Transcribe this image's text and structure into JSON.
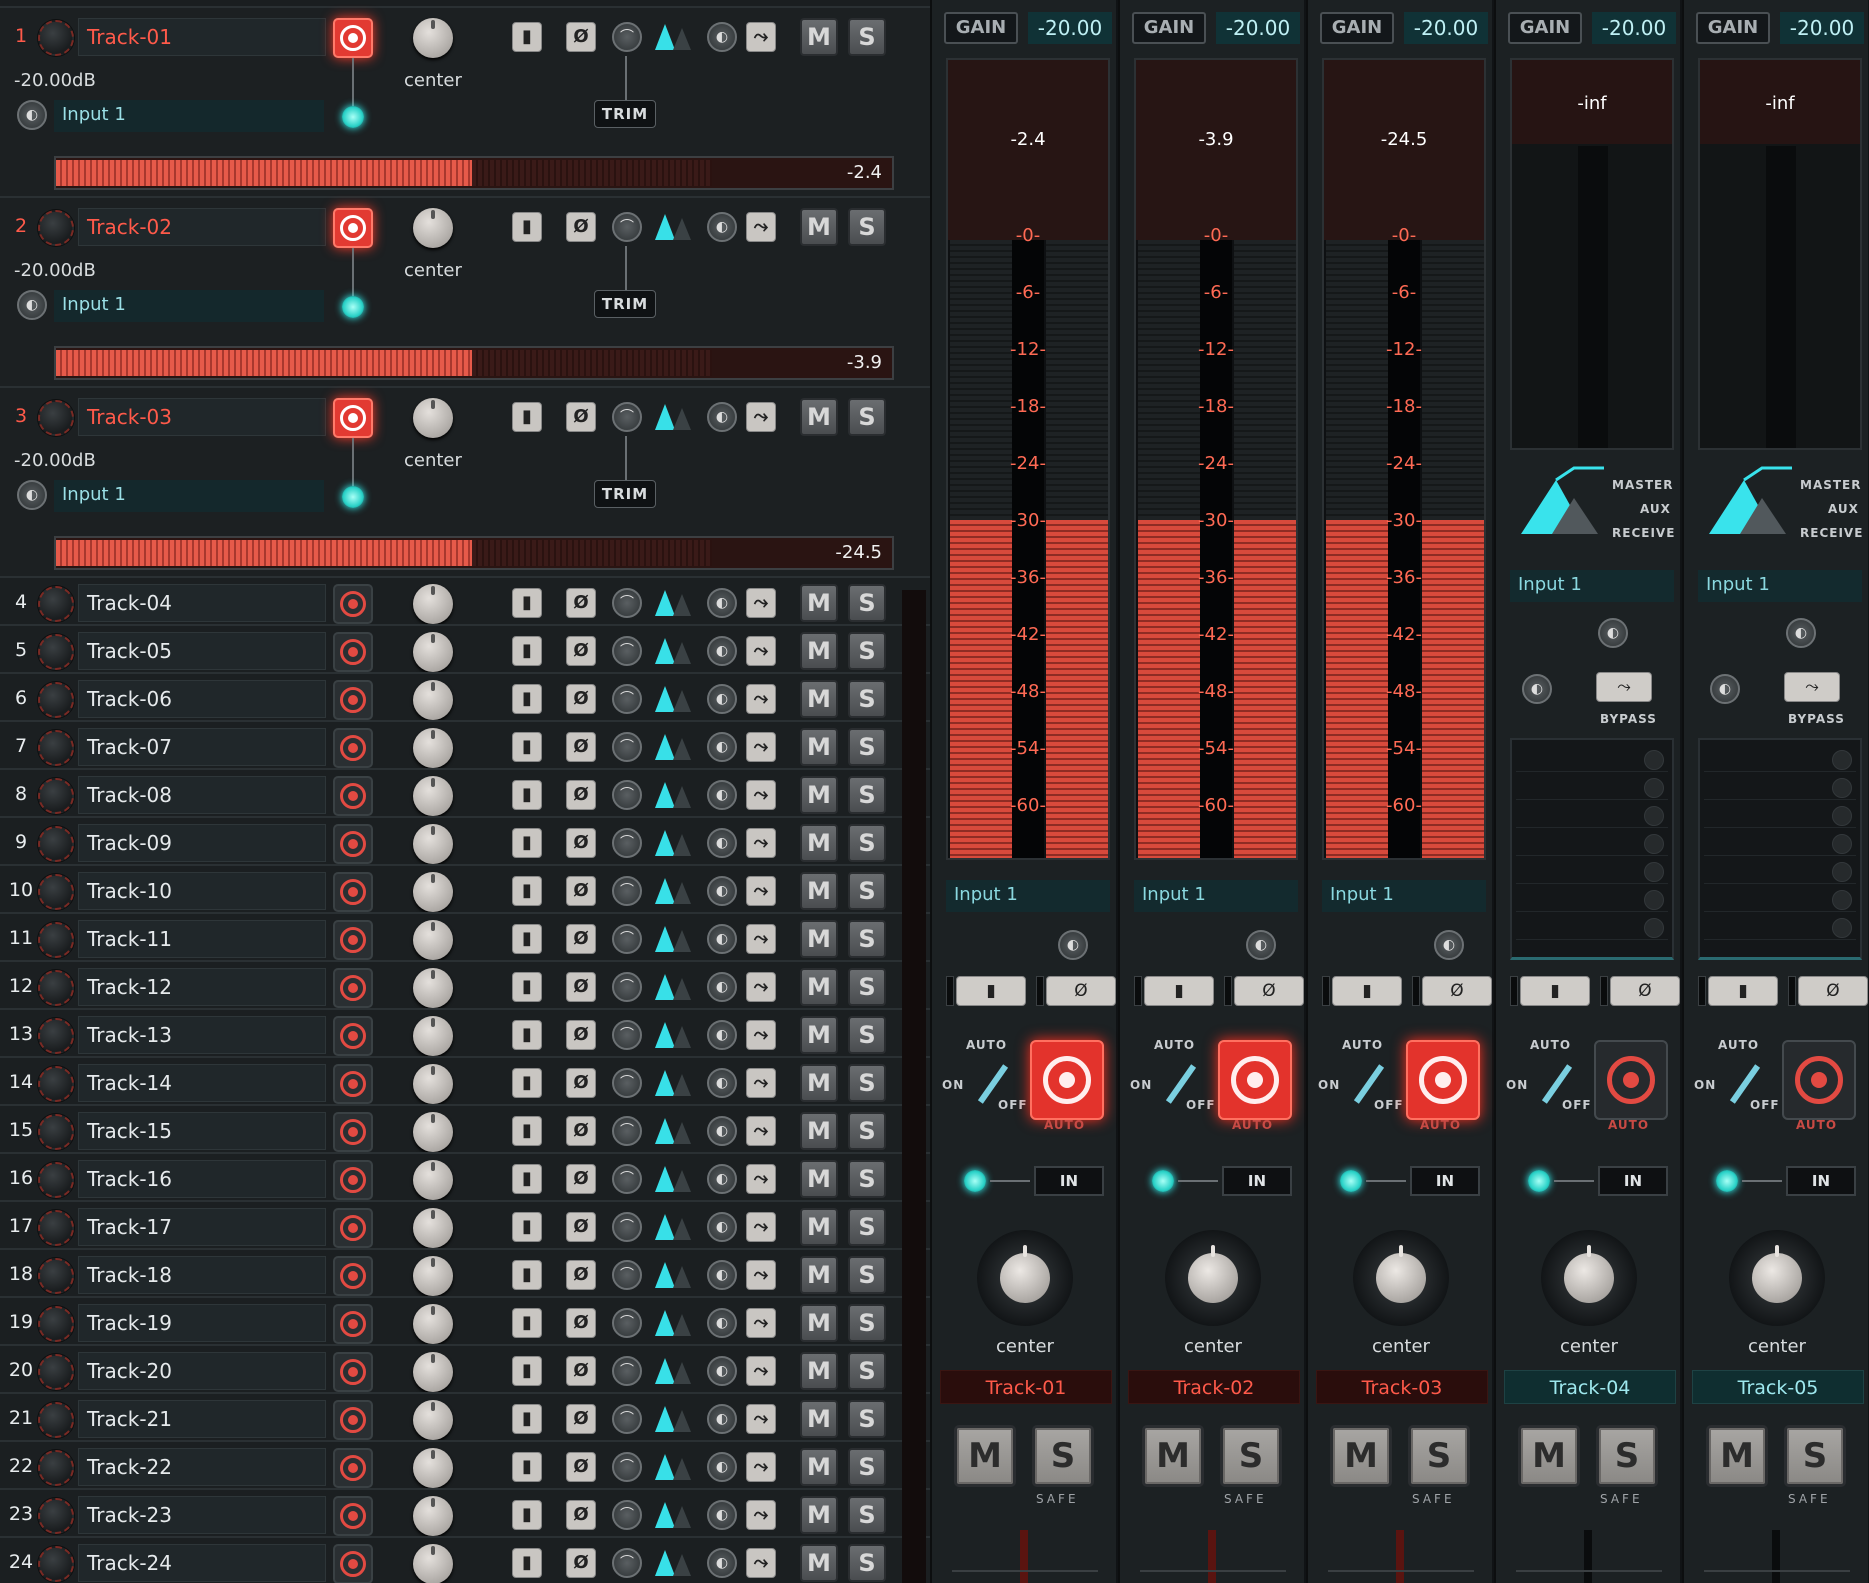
{
  "tracks": [
    {
      "num": "1",
      "name": "Track-01",
      "armed": true,
      "expanded": true,
      "gain": "-20.00dB",
      "input": "Input 1",
      "pan": "center",
      "trim": "TRIM",
      "level": "-2.4"
    },
    {
      "num": "2",
      "name": "Track-02",
      "armed": true,
      "expanded": true,
      "gain": "-20.00dB",
      "input": "Input 1",
      "pan": "center",
      "trim": "TRIM",
      "level": "-3.9"
    },
    {
      "num": "3",
      "name": "Track-03",
      "armed": true,
      "expanded": true,
      "gain": "-20.00dB",
      "input": "Input 1",
      "pan": "center",
      "trim": "TRIM",
      "level": "-24.5"
    },
    {
      "num": "4",
      "name": "Track-04"
    },
    {
      "num": "5",
      "name": "Track-05"
    },
    {
      "num": "6",
      "name": "Track-06"
    },
    {
      "num": "7",
      "name": "Track-07"
    },
    {
      "num": "8",
      "name": "Track-08"
    },
    {
      "num": "9",
      "name": "Track-09"
    },
    {
      "num": "10",
      "name": "Track-10"
    },
    {
      "num": "11",
      "name": "Track-11"
    },
    {
      "num": "12",
      "name": "Track-12"
    },
    {
      "num": "13",
      "name": "Track-13"
    },
    {
      "num": "14",
      "name": "Track-14"
    },
    {
      "num": "15",
      "name": "Track-15"
    },
    {
      "num": "16",
      "name": "Track-16"
    },
    {
      "num": "17",
      "name": "Track-17"
    },
    {
      "num": "18",
      "name": "Track-18"
    },
    {
      "num": "19",
      "name": "Track-19"
    },
    {
      "num": "20",
      "name": "Track-20"
    },
    {
      "num": "21",
      "name": "Track-21"
    },
    {
      "num": "22",
      "name": "Track-22"
    },
    {
      "num": "23",
      "name": "Track-23"
    },
    {
      "num": "24",
      "name": "Track-24"
    }
  ],
  "row_buttons": {
    "mute": "M",
    "solo": "S",
    "phase": "Ø"
  },
  "strips": [
    {
      "name": "Track-01",
      "rec": true,
      "gain_label": "GAIN",
      "gain": "-20.00",
      "peak": "-2.4",
      "type": "meter",
      "input": "Input 1",
      "pan": "center",
      "level_pct": 0.55
    },
    {
      "name": "Track-02",
      "rec": true,
      "gain_label": "GAIN",
      "gain": "-20.00",
      "peak": "-3.9",
      "type": "meter",
      "input": "Input 1",
      "pan": "center",
      "level_pct": 0.55
    },
    {
      "name": "Track-03",
      "rec": true,
      "gain_label": "GAIN",
      "gain": "-20.00",
      "peak": "-24.5",
      "type": "meter",
      "input": "Input 1",
      "pan": "center",
      "level_pct": 0.55
    },
    {
      "name": "Track-04",
      "rec": false,
      "gain_label": "GAIN",
      "gain": "-20.00",
      "peak": "-inf",
      "type": "aux",
      "input": "Input 1",
      "pan": "center"
    },
    {
      "name": "Track-05",
      "rec": false,
      "gain_label": "GAIN",
      "gain": "-20.00",
      "peak": "-inf",
      "type": "aux",
      "input": "Input 1",
      "pan": "center"
    }
  ],
  "meter_ticks": [
    "-0-",
    "-6-",
    "-12-",
    "-18-",
    "-24-",
    "-30-",
    "-36-",
    "-42-",
    "-48-",
    "-54-",
    "-60-"
  ],
  "aux_labels": {
    "master": "MASTER",
    "aux": "AUX",
    "receive": "RECEIVE",
    "bypass": "BYPASS"
  },
  "strip_labels": {
    "auto": "AUTO",
    "on": "ON",
    "off": "OFF",
    "auto_under": "AUTO",
    "in": "IN",
    "mute": "M",
    "solo": "S",
    "safe": "SAFE"
  }
}
